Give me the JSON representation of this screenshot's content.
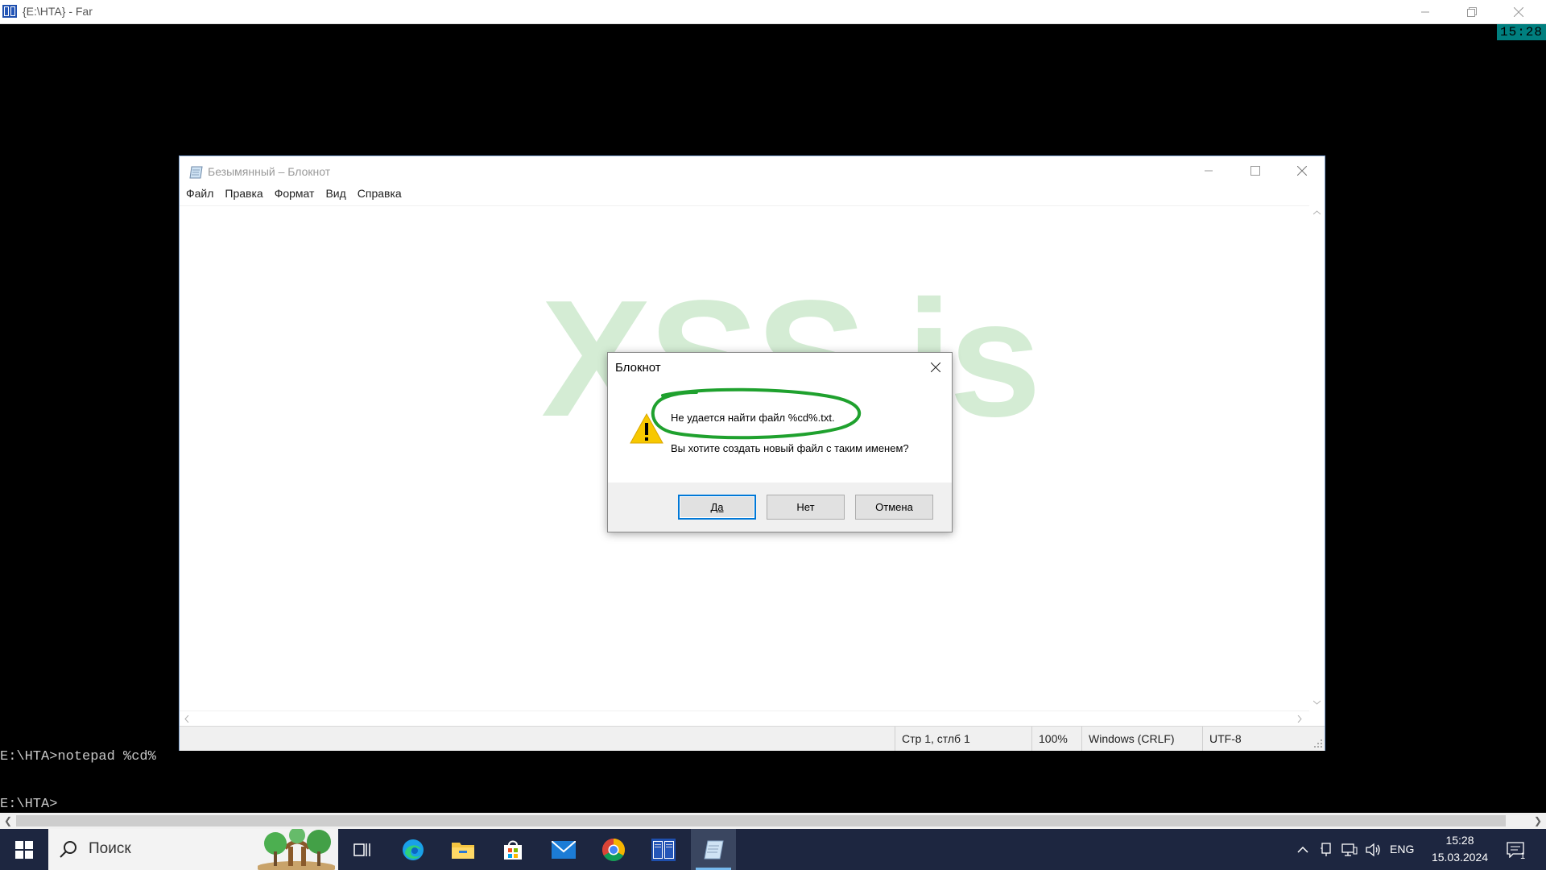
{
  "far": {
    "window_title": "{E:\\HTA} - Far",
    "clock": "15:28",
    "console_lines": [
      "E:\\HTA>notepad %cd%",
      "E:\\HTA>"
    ]
  },
  "notepad": {
    "title": "Безымянный – Блокнот",
    "menu": [
      "Файл",
      "Правка",
      "Формат",
      "Вид",
      "Справка"
    ],
    "status": {
      "position": "Стр 1, стлб 1",
      "zoom": "100%",
      "line_endings": "Windows (CRLF)",
      "encoding": "UTF-8"
    }
  },
  "watermark": "XSS.is",
  "dialog": {
    "title": "Блокнот",
    "message_line1": "Не удается найти файл %cd%.txt.",
    "message_line2": "Вы хотите создать новый файл с таким именем?",
    "buttons": {
      "yes": "Да",
      "no": "Нет",
      "cancel": "Отмена"
    }
  },
  "taskbar": {
    "search_placeholder": "Поиск",
    "apps": [
      "task-view-icon",
      "edge-icon",
      "file-explorer-icon",
      "store-icon",
      "mail-icon",
      "chrome-icon",
      "far-manager-icon",
      "notepad-icon"
    ],
    "tray": {
      "language": "ENG",
      "time": "15:28",
      "date": "15.03.2024",
      "notification_count": "1"
    }
  },
  "colors": {
    "taskbar_bg": "#1d2640",
    "accent": "#0078d7",
    "highlight_ellipse": "#1fa12e",
    "far_clock_bg": "#007f7f"
  }
}
